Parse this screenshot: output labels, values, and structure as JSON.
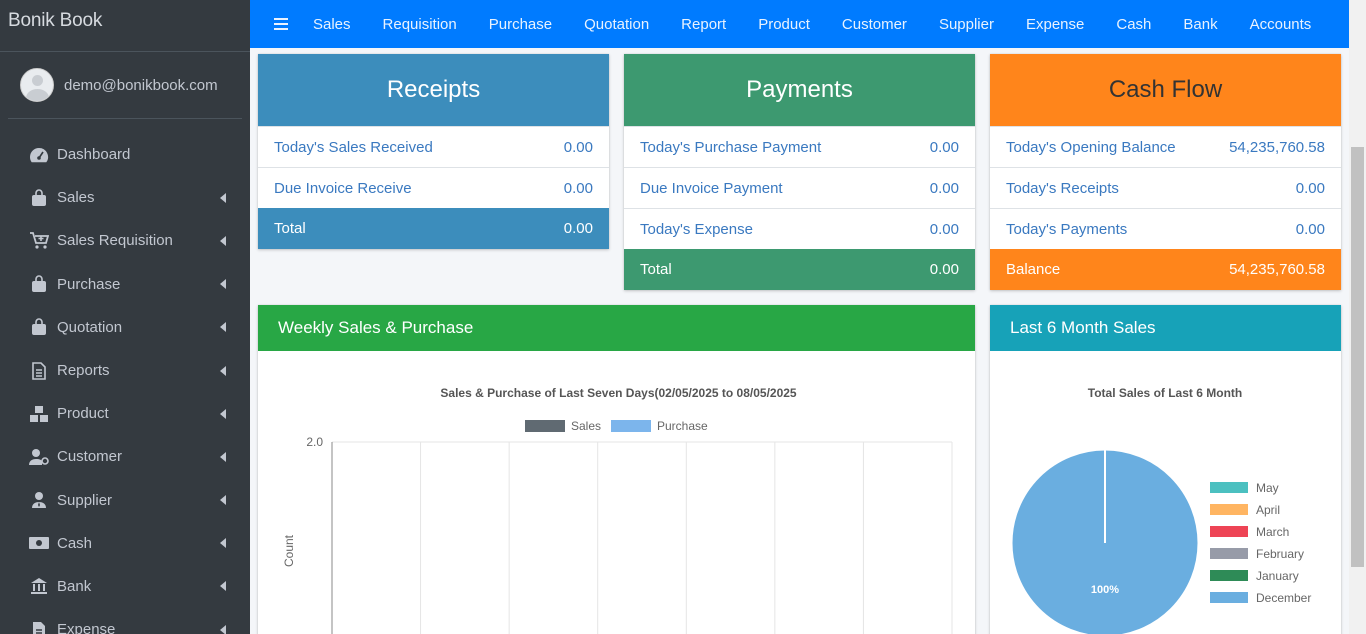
{
  "brand": "Bonik Book",
  "user": {
    "email": "demo@bonikbook.com"
  },
  "sidebar": {
    "items": [
      {
        "label": "Dashboard",
        "icon": "dashboard-icon",
        "submenu": false
      },
      {
        "label": "Sales",
        "icon": "shopping-bag-icon",
        "submenu": true
      },
      {
        "label": "Sales Requisition",
        "icon": "cart-plus-icon",
        "submenu": true
      },
      {
        "label": "Purchase",
        "icon": "shopping-bag-icon",
        "submenu": true
      },
      {
        "label": "Quotation",
        "icon": "shopping-bag-icon",
        "submenu": true
      },
      {
        "label": "Reports",
        "icon": "file-icon",
        "submenu": true
      },
      {
        "label": "Product",
        "icon": "cubes-icon",
        "submenu": true
      },
      {
        "label": "Customer",
        "icon": "user-settings-icon",
        "submenu": true
      },
      {
        "label": "Supplier",
        "icon": "user-tie-icon",
        "submenu": true
      },
      {
        "label": "Cash",
        "icon": "money-icon",
        "submenu": true
      },
      {
        "label": "Bank",
        "icon": "bank-icon",
        "submenu": true
      },
      {
        "label": "Expense",
        "icon": "file-invoice-icon",
        "submenu": true
      }
    ]
  },
  "topnav": [
    "Sales",
    "Requisition",
    "Purchase",
    "Quotation",
    "Report",
    "Product",
    "Customer",
    "Supplier",
    "Expense",
    "Cash",
    "Bank",
    "Accounts"
  ],
  "receipts": {
    "title": "Receipts",
    "rows": [
      {
        "label": "Today's Sales Received",
        "value": "0.00"
      },
      {
        "label": "Due Invoice Receive",
        "value": "0.00"
      }
    ],
    "total": {
      "label": "Total",
      "value": "0.00"
    }
  },
  "payments": {
    "title": "Payments",
    "rows": [
      {
        "label": "Today's Purchase Payment",
        "value": "0.00"
      },
      {
        "label": "Due Invoice Payment",
        "value": "0.00"
      },
      {
        "label": "Today's Expense",
        "value": "0.00"
      }
    ],
    "total": {
      "label": "Total",
      "value": "0.00"
    }
  },
  "cashflow": {
    "title": "Cash Flow",
    "rows": [
      {
        "label": "Today's Opening Balance",
        "value": "54,235,760.58"
      },
      {
        "label": "Today's Receipts",
        "value": "0.00"
      },
      {
        "label": "Today's Payments",
        "value": "0.00"
      }
    ],
    "total": {
      "label": "Balance",
      "value": "54,235,760.58"
    }
  },
  "weekly_card": {
    "title": "Weekly Sales & Purchase"
  },
  "monthly_card": {
    "title": "Last 6 Month Sales"
  },
  "colors": {
    "sales": "#606a72",
    "purchase": "#7cb5ec",
    "pie": [
      "#4bc0c0",
      "#ffb562",
      "#ee4455",
      "#979ba8",
      "#2e8b57",
      "#6aaee0"
    ]
  },
  "chart_data": [
    {
      "type": "bar",
      "title": "Sales & Purchase of Last Seven Days(02/05/2025 to 08/05/2025",
      "ylabel": "Count",
      "xlabel": "",
      "ylim": [
        0,
        2.0
      ],
      "y_ticks": [
        "2.0"
      ],
      "legend_position": "top",
      "grid": true,
      "categories": [
        "",
        "",
        "",
        "",
        "",
        "",
        ""
      ],
      "series": [
        {
          "name": "Sales",
          "values": [
            0,
            0,
            0,
            0,
            0,
            0,
            0
          ]
        },
        {
          "name": "Purchase",
          "values": [
            0,
            0,
            0,
            0,
            0,
            0,
            0
          ]
        }
      ]
    },
    {
      "type": "pie",
      "title": "Total Sales of Last 6 Month",
      "legend_position": "right",
      "categories": [
        "May",
        "April",
        "March",
        "February",
        "January",
        "December"
      ],
      "values": [
        0,
        0,
        0,
        0,
        0,
        100
      ],
      "data_labels": [
        "",
        "",
        "",
        "",
        "",
        "100%"
      ]
    }
  ]
}
